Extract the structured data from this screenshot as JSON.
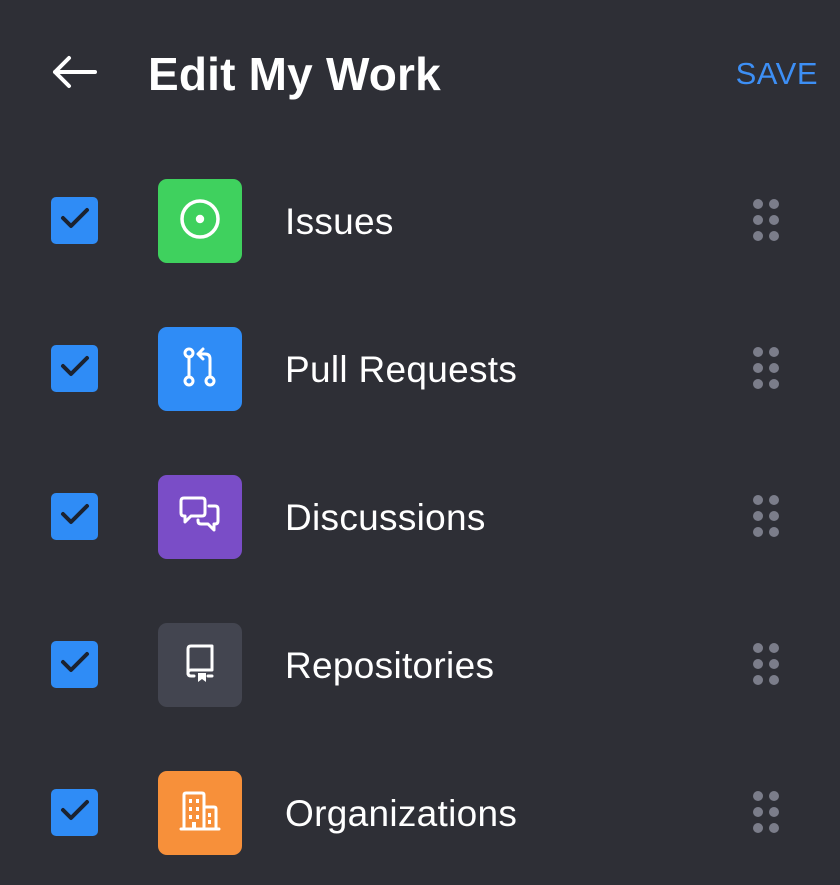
{
  "header": {
    "back_icon": "arrow-left-icon",
    "title": "Edit My Work",
    "save_label": "SAVE"
  },
  "colors": {
    "background": "#2e2f36",
    "accent": "#3d8ff5",
    "checkbox": "#2f8cf6",
    "drag_dots": "#7b7d8a"
  },
  "items": [
    {
      "label": "Issues",
      "checked": true,
      "icon": "issue-opened-icon",
      "tile_color": "#3fd15e"
    },
    {
      "label": "Pull Requests",
      "checked": true,
      "icon": "pull-request-icon",
      "tile_color": "#2f8cf6"
    },
    {
      "label": "Discussions",
      "checked": true,
      "icon": "discussions-icon",
      "tile_color": "#7a4dc7"
    },
    {
      "label": "Repositories",
      "checked": true,
      "icon": "repo-icon",
      "tile_color": "#434550"
    },
    {
      "label": "Organizations",
      "checked": true,
      "icon": "organization-icon",
      "tile_color": "#f7903a"
    }
  ]
}
